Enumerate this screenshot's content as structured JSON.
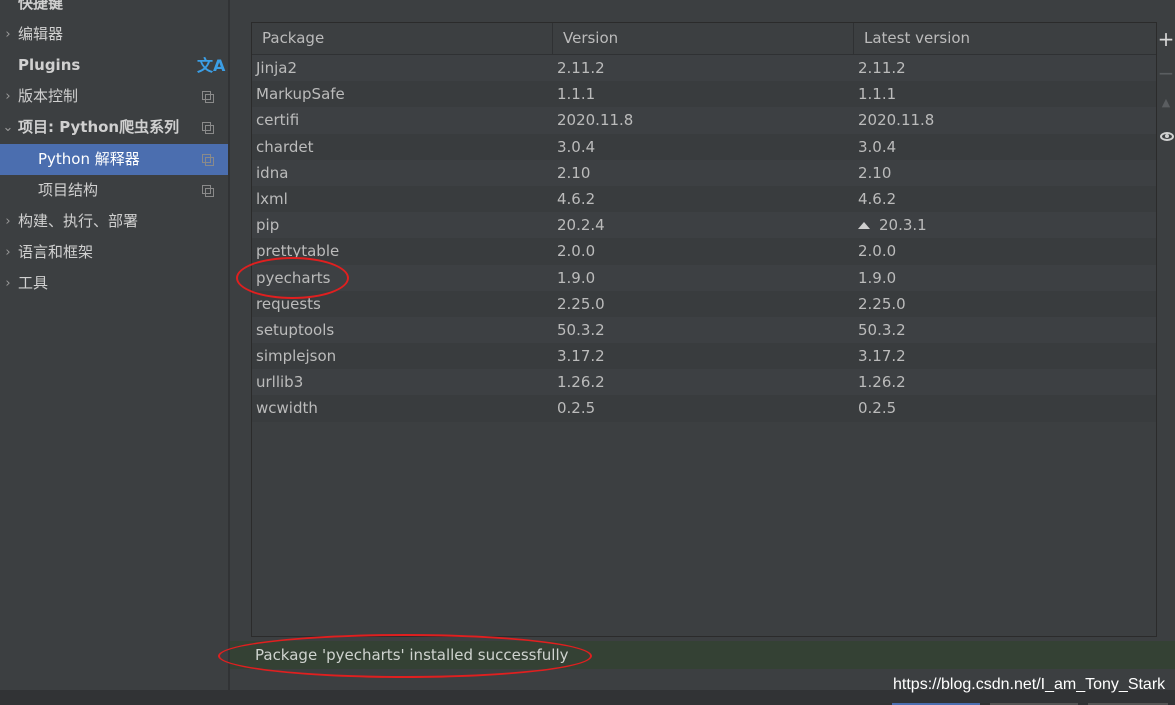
{
  "sidebar": {
    "items": [
      {
        "label": "快捷键",
        "arrow": "",
        "kind": "bold-top"
      },
      {
        "label": "编辑器",
        "arrow": "›"
      },
      {
        "label": "Plugins",
        "arrow": ""
      },
      {
        "label": "版本控制",
        "arrow": "›"
      },
      {
        "label": "项目: Python爬虫系列",
        "arrow": "⌄"
      },
      {
        "label": "Python 解释器",
        "arrow": ""
      },
      {
        "label": "项目结构",
        "arrow": ""
      },
      {
        "label": "构建、执行、部署",
        "arrow": "›"
      },
      {
        "label": "语言和框架",
        "arrow": "›"
      },
      {
        "label": "工具",
        "arrow": "›"
      }
    ],
    "translate_icon": "文A"
  },
  "table": {
    "headers": [
      "Package",
      "Version",
      "Latest version"
    ],
    "rows": [
      {
        "package": "Jinja2",
        "version": "2.11.2",
        "latest": "2.11.2"
      },
      {
        "package": "MarkupSafe",
        "version": "1.1.1",
        "latest": "1.1.1"
      },
      {
        "package": "certifi",
        "version": "2020.11.8",
        "latest": "2020.11.8"
      },
      {
        "package": "chardet",
        "version": "3.0.4",
        "latest": "3.0.4"
      },
      {
        "package": "idna",
        "version": "2.10",
        "latest": "2.10"
      },
      {
        "package": "lxml",
        "version": "4.6.2",
        "latest": "4.6.2"
      },
      {
        "package": "pip",
        "version": "20.2.4",
        "latest": "20.3.1",
        "upgrade": true
      },
      {
        "package": "prettytable",
        "version": "2.0.0",
        "latest": "2.0.0"
      },
      {
        "package": "pyecharts",
        "version": "1.9.0",
        "latest": "1.9.0"
      },
      {
        "package": "requests",
        "version": "2.25.0",
        "latest": "2.25.0"
      },
      {
        "package": "setuptools",
        "version": "50.3.2",
        "latest": "50.3.2"
      },
      {
        "package": "simplejson",
        "version": "3.17.2",
        "latest": "3.17.2"
      },
      {
        "package": "urllib3",
        "version": "1.26.2",
        "latest": "1.26.2"
      },
      {
        "package": "wcwidth",
        "version": "0.2.5",
        "latest": "0.2.5"
      }
    ]
  },
  "toolbar": {
    "add": "+",
    "remove": "−",
    "upgrade": "▲"
  },
  "status": {
    "message": "Package 'pyecharts' installed successfully"
  },
  "watermark": "https://blog.csdn.net/I_am_Tony_Stark",
  "colors": {
    "background": "#3c3f41",
    "selected": "#4b6eaf",
    "status_bg": "#344134",
    "annotation": "#e01f1f",
    "translate_icon": "#3b9ee5"
  }
}
